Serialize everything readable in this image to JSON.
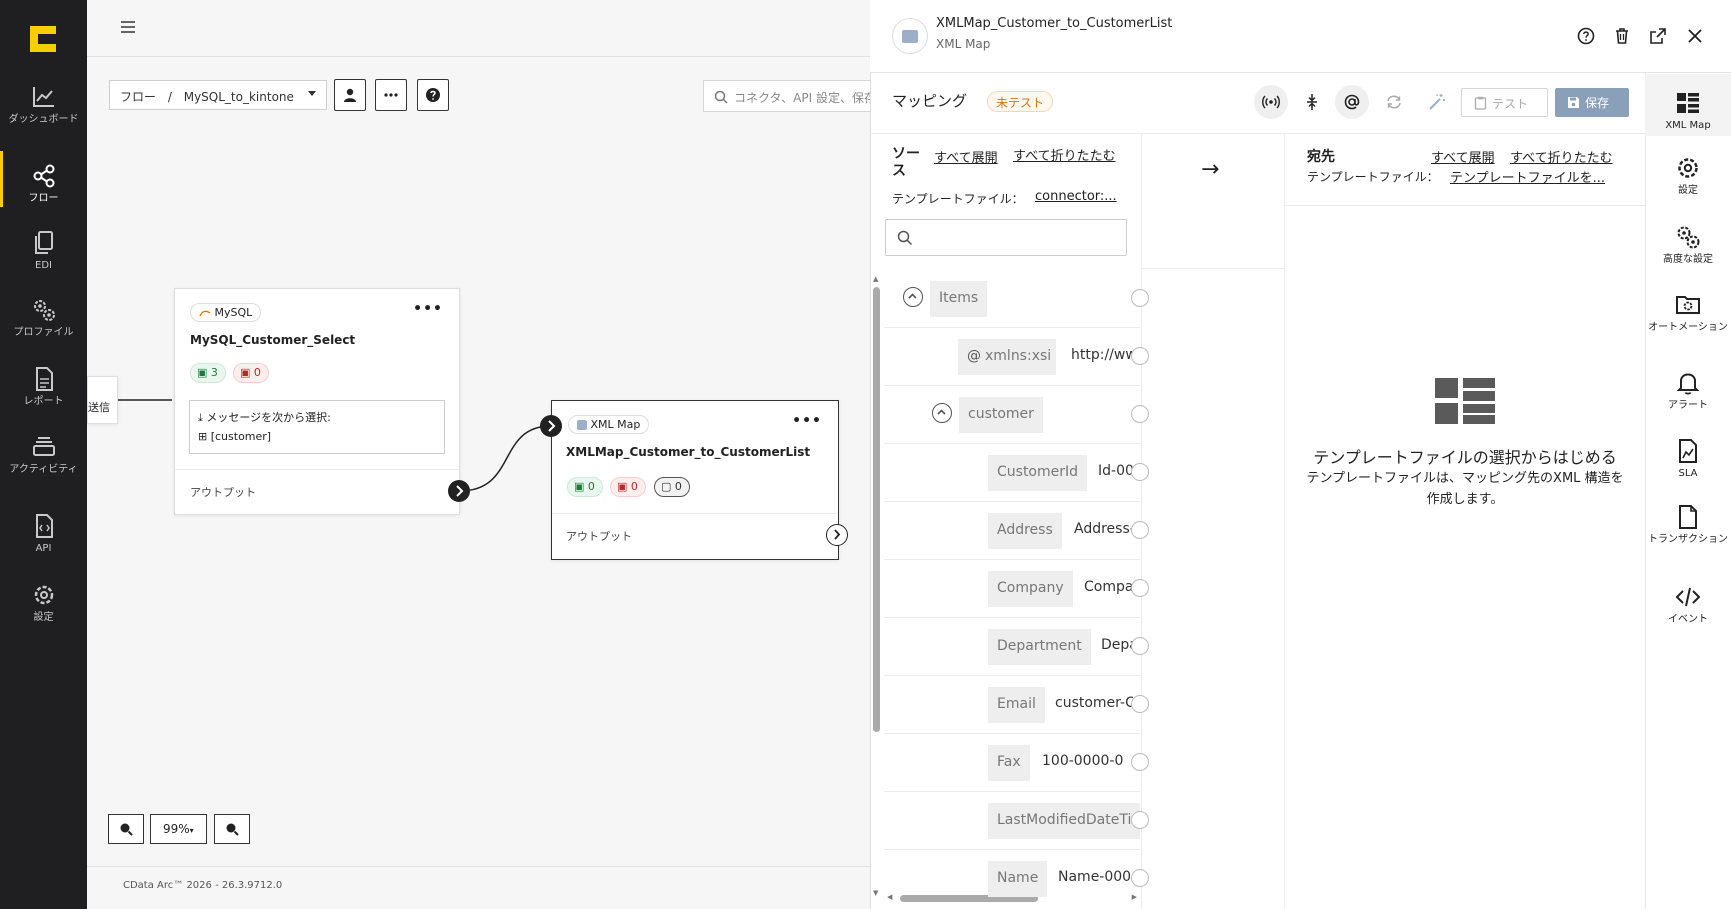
{
  "nav": {
    "items": [
      {
        "label": "ダッシュボード",
        "icon": "chart-line-icon"
      },
      {
        "label": "フロー",
        "icon": "share-nodes-icon"
      },
      {
        "label": "EDI",
        "icon": "documents-icon"
      },
      {
        "label": "プロファイル",
        "icon": "gears-icon"
      },
      {
        "label": "レポート",
        "icon": "report-icon"
      },
      {
        "label": "アクティビティ",
        "icon": "stack-icon"
      },
      {
        "label": "API",
        "icon": "api-file-icon"
      },
      {
        "label": "設定",
        "icon": "gear-icon"
      }
    ]
  },
  "canvas": {
    "breadcrumb_root": "フロー",
    "breadcrumb_sep": "/",
    "breadcrumb_flow": "MySQL_to_kintone",
    "search_placeholder": "コネクタ、API 設定、保存",
    "partial_node_label": "送信",
    "mysql_node": {
      "type": "MySQL",
      "name": "MySQL_Customer_Select",
      "count_success": "3",
      "count_error": "0",
      "input_label": "メッセージを次から選択:",
      "input_value": "[customer]",
      "output_label": "アウトプット"
    },
    "xml_node": {
      "type": "XML Map",
      "name": "XMLMap_Customer_to_CustomerList",
      "count_success": "0",
      "count_error": "0",
      "count_pending": "0",
      "output_label": "アウトプット"
    },
    "zoom": "99%",
    "footer": "CData Arc™ 2026 - 26.3.9712.0"
  },
  "panel": {
    "title": "XMLMap_Customer_to_CustomerList",
    "subtitle": "XML Map",
    "mapping_title": "マッピング",
    "badge": "未テスト",
    "test_label": "テスト",
    "save_label": "保存",
    "source": {
      "heading": "ソース",
      "expand_all": "すべて展開",
      "collapse_all": "すべて折りたたむ",
      "template_label": "テンプレートファイル：",
      "template_value": "connector:..."
    },
    "arrow": "→",
    "destination": {
      "heading": "宛先",
      "expand_all": "すべて展開",
      "collapse_all": "すべて折りたたむ",
      "template_label": "テンプレートファイル：",
      "template_value": "テンプレートファイルを..."
    },
    "tree": [
      {
        "tag": "Items",
        "value": ""
      },
      {
        "tag": "xmlns:xsi",
        "value": "http://ww"
      },
      {
        "tag": "customer",
        "value": ""
      },
      {
        "tag": "CustomerId",
        "value": "Id-00"
      },
      {
        "tag": "Address",
        "value": "Address-"
      },
      {
        "tag": "Company",
        "value": "Compa"
      },
      {
        "tag": "Department",
        "value": "Depa"
      },
      {
        "tag": "Email",
        "value": "customer-C"
      },
      {
        "tag": "Fax",
        "value": "100-0000-0"
      },
      {
        "tag": "LastModifiedDateTim",
        "value": ""
      },
      {
        "tag": "Name",
        "value": "Name-000"
      }
    ],
    "empty_title": "テンプレートファイルの選択からはじめる",
    "empty_desc_1": "テンプレートファイルは、マッピング先のXML 構造を",
    "empty_desc_2": "作成します。"
  },
  "rail": [
    {
      "label": "XML Map",
      "icon": "xml-map-icon"
    },
    {
      "label": "設定",
      "icon": "gear-icon"
    },
    {
      "label": "高度な設定",
      "icon": "gears-icon"
    },
    {
      "label": "オートメーション",
      "icon": "folder-gear-icon"
    },
    {
      "label": "アラート",
      "icon": "bell-icon"
    },
    {
      "label": "SLA",
      "icon": "sla-icon"
    },
    {
      "label": "トランザクション",
      "icon": "file-icon"
    },
    {
      "label": "イベント",
      "icon": "code-icon"
    }
  ],
  "colors": {
    "nav_bg": "#1f1f21",
    "accent_yellow": "#f5d000",
    "save_button": "#8aa0b8",
    "badge_orange": "#c6781a"
  }
}
